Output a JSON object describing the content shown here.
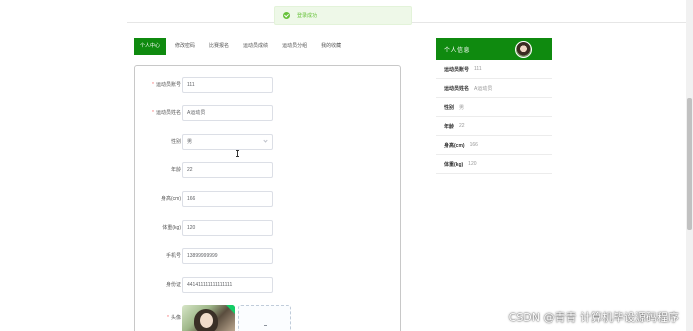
{
  "toast": {
    "message": "登录成功"
  },
  "tabs": [
    "个人中心",
    "修改密码",
    "比赛报名",
    "运动员成绩",
    "运动员分组",
    "我的收藏"
  ],
  "form": {
    "athlete_no": {
      "label": "运动员账号",
      "value": "111"
    },
    "athlete_name": {
      "label": "运动员姓名",
      "value": "A运动员"
    },
    "gender": {
      "label": "性别",
      "value": "男"
    },
    "age": {
      "label": "年龄",
      "value": "22"
    },
    "height": {
      "label": "身高(cm)",
      "value": "166"
    },
    "weight": {
      "label": "体重(kg)",
      "value": "120"
    },
    "phone": {
      "label": "手机号",
      "value": "13899999999"
    },
    "id_card": {
      "label": "身份证",
      "value": "441411111111111111"
    },
    "avatar": {
      "label": "头像"
    },
    "required_mark": "*"
  },
  "info": {
    "title": "个人信息",
    "rows": [
      {
        "k": "运动员账号",
        "v": "111"
      },
      {
        "k": "运动员姓名",
        "v": "A运动员"
      },
      {
        "k": "性别",
        "v": "男"
      },
      {
        "k": "年龄",
        "v": "22"
      },
      {
        "k": "身高(cm)",
        "v": "166"
      },
      {
        "k": "体重(kg)",
        "v": "120"
      }
    ]
  },
  "watermark": "CSDN @青青  计算机毕设源码程序",
  "colors": {
    "primary": "#0f8a0f",
    "success": "#67c23a",
    "required": "#f56c6c"
  }
}
